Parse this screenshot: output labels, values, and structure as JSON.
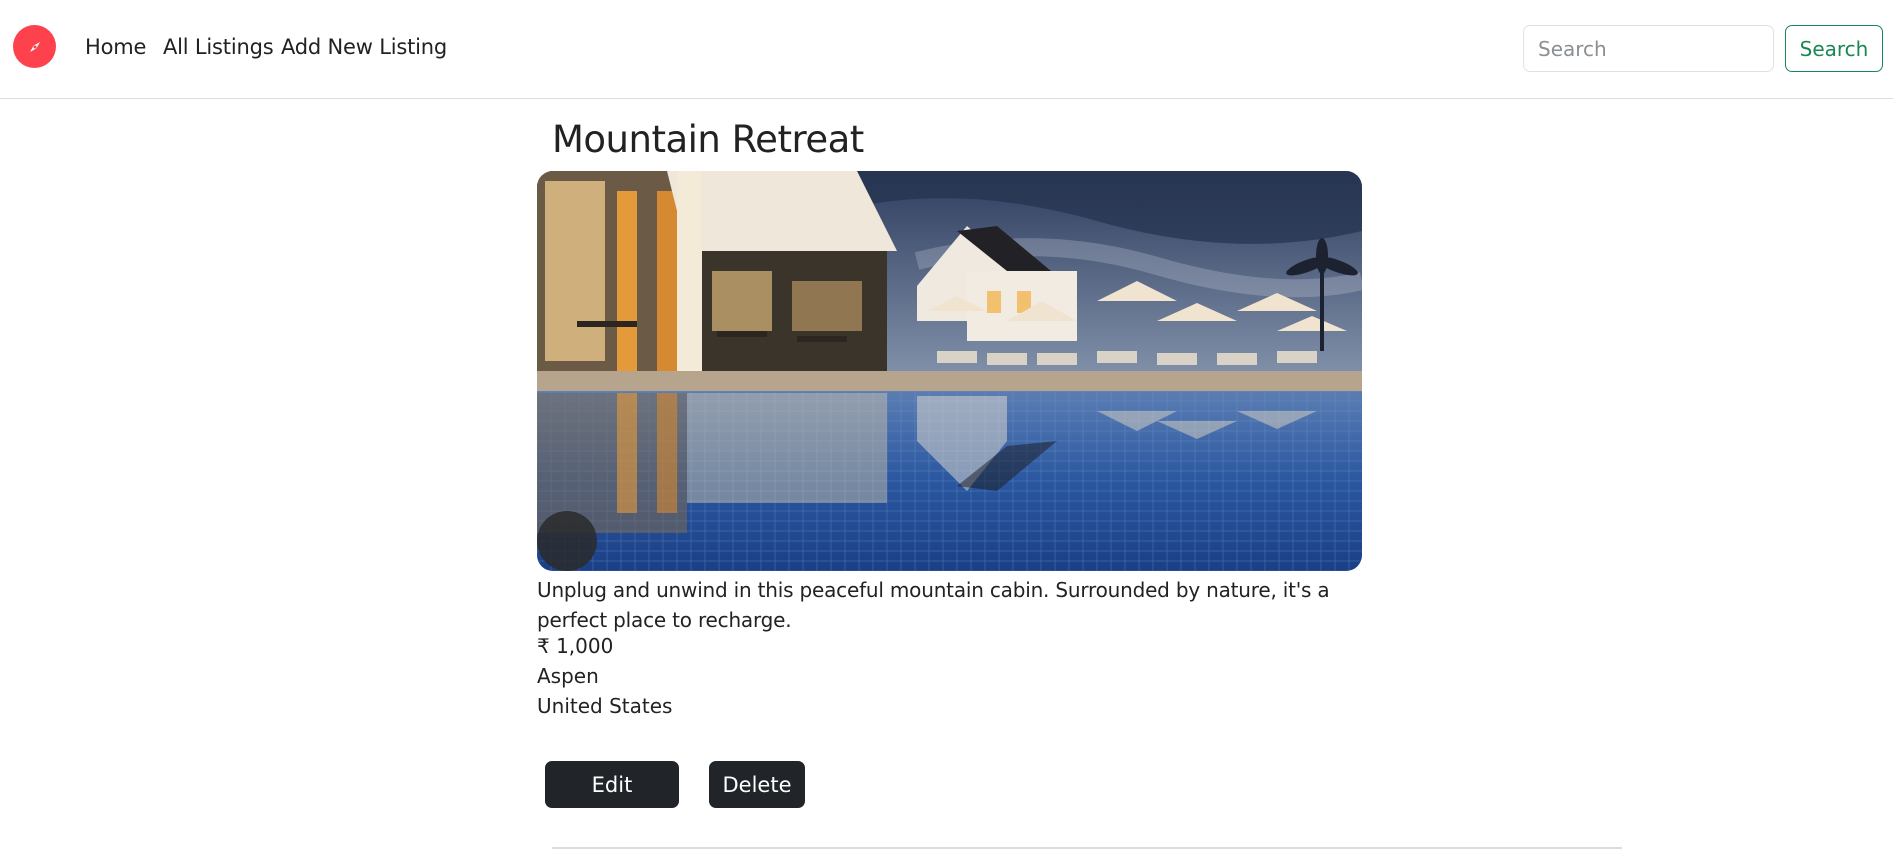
{
  "navbar": {
    "logo_icon": "compass-icon",
    "brand_color": "#fe424d",
    "links": [
      "Home",
      "All Listings",
      "Add New Listing"
    ],
    "search": {
      "placeholder": "Search",
      "value": "",
      "button_label": "Search",
      "button_color": "#198754"
    }
  },
  "listing": {
    "title": "Mountain Retreat",
    "image_alt": "resort pool at dusk",
    "description": "Unplug and unwind in this peaceful mountain cabin. Surrounded by nature, it's a perfect place to recharge.",
    "price": "₹ 1,000",
    "location": "Aspen",
    "country": "United States"
  },
  "actions": {
    "edit_label": "Edit",
    "delete_label": "Delete",
    "button_color": "#212529"
  }
}
